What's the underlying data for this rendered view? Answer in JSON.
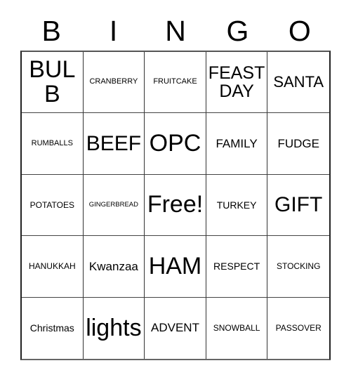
{
  "card": {
    "title": "BINGO",
    "header_letters": [
      "B",
      "I",
      "N",
      "G",
      "O"
    ],
    "free_space_label": "Free!",
    "colors": {
      "background": "#ffffff",
      "text": "#000000",
      "grid_line": "#333333",
      "grid_border": "#222222"
    },
    "rows": [
      [
        {
          "label": "BULB",
          "size": "fs-xxl"
        },
        {
          "label": "CRANBERRY",
          "size": "fs-3xs"
        },
        {
          "label": "FRUITCAKE",
          "size": "fs-3xs"
        },
        {
          "label": "FEAST DAY",
          "size": "fs-l"
        },
        {
          "label": "SANTA",
          "size": "fs-m"
        }
      ],
      [
        {
          "label": "RUMBALLS",
          "size": "fs-3xs"
        },
        {
          "label": "BEEF",
          "size": "fs-xl"
        },
        {
          "label": "OPC",
          "size": "fs-xxl"
        },
        {
          "label": "FAMILY",
          "size": "fs-s"
        },
        {
          "label": "FUDGE",
          "size": "fs-s"
        }
      ],
      [
        {
          "label": "POTATOES",
          "size": "fs-xxs"
        },
        {
          "label": "GINGERBREAD",
          "size": "fs-4xs"
        },
        {
          "label": "Free!",
          "size": "fs-xxl"
        },
        {
          "label": "TURKEY",
          "size": "fs-xs"
        },
        {
          "label": "GIFT",
          "size": "fs-xl"
        }
      ],
      [
        {
          "label": "HANUKKAH",
          "size": "fs-xxs"
        },
        {
          "label": "Kwanzaa",
          "size": "fs-s"
        },
        {
          "label": "HAM",
          "size": "fs-xxl"
        },
        {
          "label": "RESPECT",
          "size": "fs-xs"
        },
        {
          "label": "STOCKING",
          "size": "fs-xxs"
        }
      ],
      [
        {
          "label": "Christmas",
          "size": "fs-xs"
        },
        {
          "label": "lights",
          "size": "fs-xxl"
        },
        {
          "label": "ADVENT",
          "size": "fs-s"
        },
        {
          "label": "SNOWBALL",
          "size": "fs-xxs"
        },
        {
          "label": "PASSOVER",
          "size": "fs-xxs"
        }
      ]
    ]
  }
}
